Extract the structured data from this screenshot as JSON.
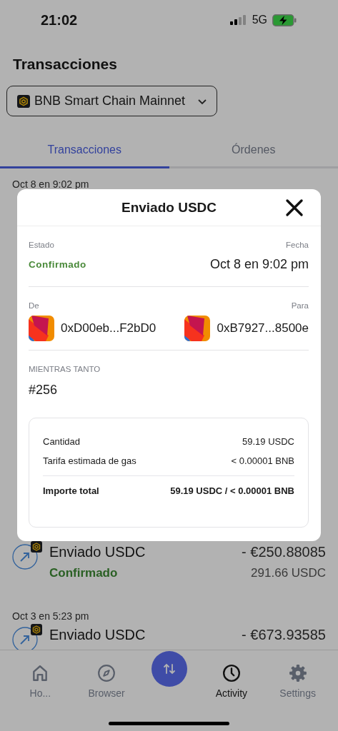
{
  "status_bar": {
    "time": "21:02",
    "network": "5G"
  },
  "header": {
    "title": "Transacciones"
  },
  "network_selector": {
    "label": "BNB Smart Chain Mainnet"
  },
  "tabs": [
    {
      "label": "Transacciones",
      "selected": true
    },
    {
      "label": "Órdenes",
      "selected": false
    }
  ],
  "activity": [
    {
      "kind": "date",
      "text": "Oct 8 en 9:02 pm"
    },
    {
      "kind": "tx",
      "title": "Enviado USDC",
      "status": "Confirmado",
      "fiat": "- €250.88085",
      "amount": "291.66 USDC"
    },
    {
      "kind": "date",
      "text": "Oct 3 en 5:23 pm"
    },
    {
      "kind": "tx",
      "title": "Enviado USDC",
      "fiat": "- €673.93585"
    }
  ],
  "modal": {
    "title": "Enviado USDC",
    "status": {
      "label": "Estado",
      "value": "Confirmado"
    },
    "date": {
      "label": "Fecha",
      "value": "Oct 8 en 9:02 pm"
    },
    "from": {
      "label": "De",
      "address": "0xD00eb...F2bD0"
    },
    "to": {
      "label": "Para",
      "address": "0xB7927...8500e"
    },
    "nonce": {
      "label": "MIENTRAS TANTO",
      "value": "#256"
    },
    "summary": [
      {
        "kind": "line",
        "label": "Cantidad",
        "value": "59.19 USDC"
      },
      {
        "kind": "line",
        "label": "Tarifa estimada de gas",
        "value": "< 0.00001 BNB"
      },
      {
        "kind": "total",
        "label": "Importe total",
        "value": "59.19 USDC / < 0.00001 BNB"
      }
    ]
  },
  "nav": [
    {
      "kind": "home",
      "label": "Ho...",
      "selected": false
    },
    {
      "kind": "browser",
      "label": "Browser",
      "selected": false
    },
    {
      "kind": "swap"
    },
    {
      "kind": "activity",
      "label": "Activity",
      "selected": true
    },
    {
      "kind": "settings",
      "label": "Settings",
      "selected": false
    }
  ]
}
